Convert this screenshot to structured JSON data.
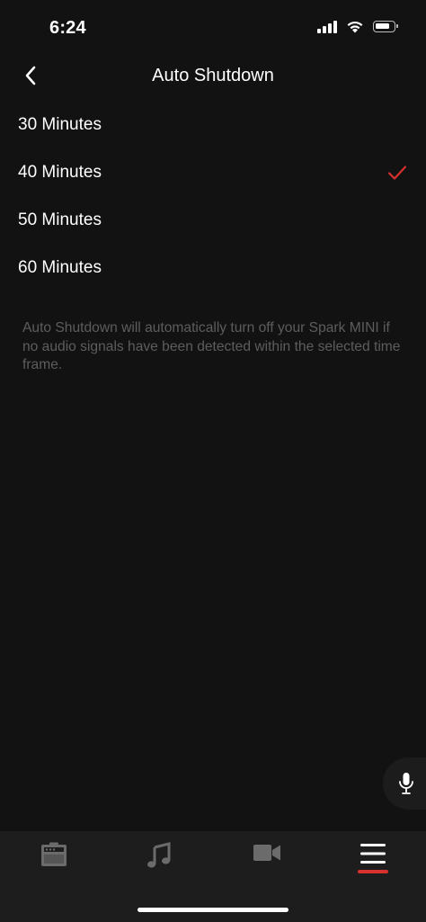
{
  "status_bar": {
    "time": "6:24",
    "icons": [
      "cellular-signal-icon",
      "wifi-icon",
      "battery-icon"
    ]
  },
  "header": {
    "title": "Auto Shutdown",
    "back_icon": "chevron-left-icon"
  },
  "options": [
    {
      "label": "30 Minutes",
      "selected": false
    },
    {
      "label": "40 Minutes",
      "selected": true
    },
    {
      "label": "50 Minutes",
      "selected": false
    },
    {
      "label": "60 Minutes",
      "selected": false
    }
  ],
  "description": "Auto Shutdown will automatically turn off your Spark MINI if no audio signals have been detected within the selected time frame.",
  "mic_button": {
    "icon": "microphone-icon"
  },
  "tab_bar": {
    "tabs": [
      {
        "icon": "amp-icon",
        "active": false
      },
      {
        "icon": "music-note-icon",
        "active": false
      },
      {
        "icon": "video-camera-icon",
        "active": false
      },
      {
        "icon": "menu-icon",
        "active": true
      }
    ]
  },
  "colors": {
    "background": "#121212",
    "accent": "#d8302d",
    "description_text": "#5d5d5d",
    "tab_bar": "#1d1d1d",
    "inactive_icon": "#6b6b6b"
  }
}
